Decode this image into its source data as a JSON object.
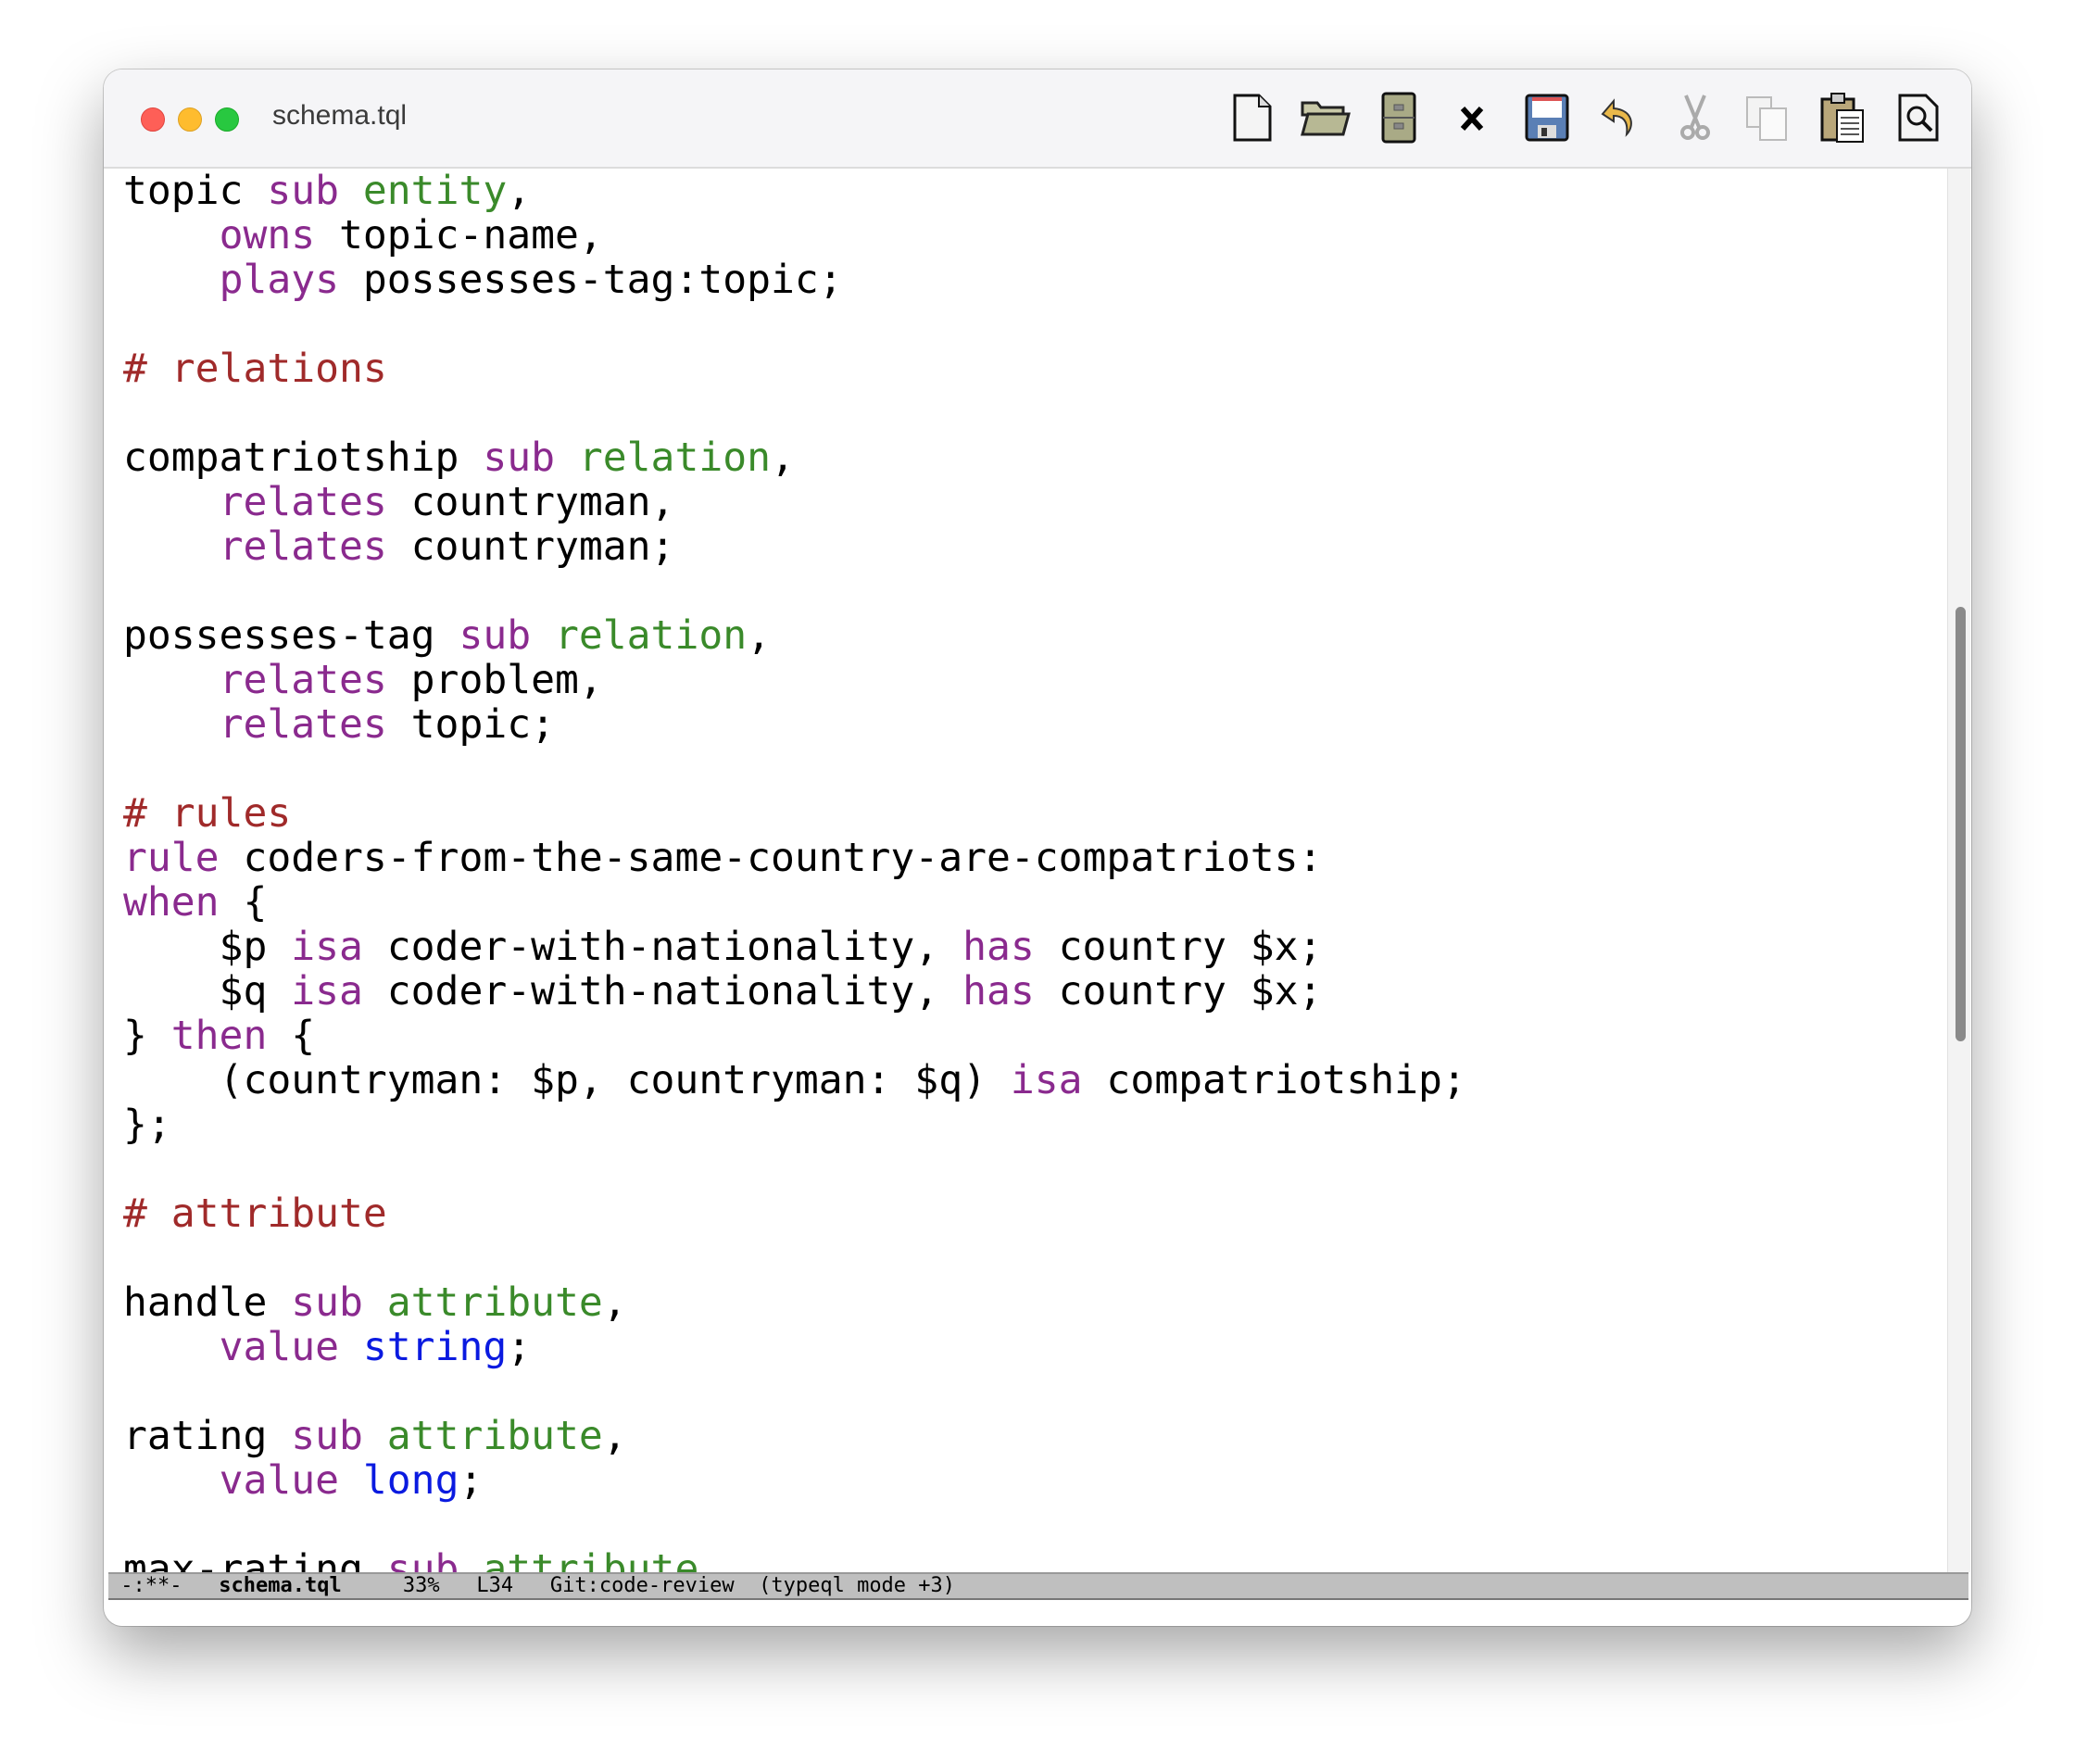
{
  "window": {
    "title": "schema.tql"
  },
  "toolbar": [
    {
      "icon": "new-file-icon"
    },
    {
      "icon": "open-folder-icon"
    },
    {
      "icon": "file-cabinet-icon"
    },
    {
      "icon": "close-icon"
    },
    {
      "icon": "save-icon"
    },
    {
      "icon": "undo-icon"
    },
    {
      "icon": "cut-icon",
      "disabled": true
    },
    {
      "icon": "copy-icon",
      "disabled": true
    },
    {
      "icon": "paste-icon"
    },
    {
      "icon": "search-icon"
    }
  ],
  "colors": {
    "keyword": "#8a2a8e",
    "type": "#3a8a2a",
    "comment": "#a02a2a",
    "builtin": "#0a1ae0"
  },
  "code_lines": [
    [
      [
        "",
        "topic "
      ],
      [
        "kw",
        "sub"
      ],
      [
        "",
        " "
      ],
      [
        "ty",
        "entity"
      ],
      [
        "",
        ","
      ]
    ],
    [
      [
        "",
        "    "
      ],
      [
        "kw",
        "owns"
      ],
      [
        "",
        " topic-name,"
      ]
    ],
    [
      [
        "",
        "    "
      ],
      [
        "kw",
        "plays"
      ],
      [
        "",
        " possesses-tag:topic;"
      ]
    ],
    [],
    [
      [
        "cm",
        "# relations"
      ]
    ],
    [],
    [
      [
        "",
        "compatriotship "
      ],
      [
        "kw",
        "sub"
      ],
      [
        "",
        " "
      ],
      [
        "ty",
        "relation"
      ],
      [
        "",
        ","
      ]
    ],
    [
      [
        "",
        "    "
      ],
      [
        "kw",
        "relates"
      ],
      [
        "",
        " countryman,"
      ]
    ],
    [
      [
        "",
        "    "
      ],
      [
        "kw",
        "relates"
      ],
      [
        "",
        " countryman;"
      ]
    ],
    [],
    [
      [
        "",
        "possesses-tag "
      ],
      [
        "kw",
        "sub"
      ],
      [
        "",
        " "
      ],
      [
        "ty",
        "relation"
      ],
      [
        "",
        ","
      ]
    ],
    [
      [
        "",
        "    "
      ],
      [
        "kw",
        "relates"
      ],
      [
        "",
        " problem,"
      ]
    ],
    [
      [
        "",
        "    "
      ],
      [
        "kw",
        "relates"
      ],
      [
        "",
        " topic;"
      ]
    ],
    [],
    [
      [
        "cm",
        "# rules"
      ]
    ],
    [
      [
        "kw",
        "rule"
      ],
      [
        "",
        " coders-from-the-same-country-are-compatriots:"
      ]
    ],
    [
      [
        "kw",
        "when"
      ],
      [
        "",
        " {"
      ]
    ],
    [
      [
        "",
        "    $p "
      ],
      [
        "kw",
        "isa"
      ],
      [
        "",
        " coder-with-nationality, "
      ],
      [
        "kw",
        "has"
      ],
      [
        "",
        " country $x;"
      ]
    ],
    [
      [
        "",
        "    $q "
      ],
      [
        "kw",
        "isa"
      ],
      [
        "",
        " coder-with-nationality, "
      ],
      [
        "kw",
        "has"
      ],
      [
        "",
        " country $x;"
      ]
    ],
    [
      [
        "",
        "} "
      ],
      [
        "kw",
        "then"
      ],
      [
        "",
        " {"
      ]
    ],
    [
      [
        "",
        "    (countryman: $p, countryman: $q) "
      ],
      [
        "kw",
        "isa"
      ],
      [
        "",
        " compatriotship;"
      ]
    ],
    [
      [
        "",
        "};"
      ]
    ],
    [],
    [
      [
        "cm",
        "# attribute"
      ]
    ],
    [],
    [
      [
        "",
        "handle "
      ],
      [
        "kw",
        "sub"
      ],
      [
        "",
        " "
      ],
      [
        "ty",
        "attribute"
      ],
      [
        "",
        ","
      ]
    ],
    [
      [
        "",
        "    "
      ],
      [
        "kw",
        "value"
      ],
      [
        "",
        " "
      ],
      [
        "bt",
        "string"
      ],
      [
        "",
        ";"
      ]
    ],
    [],
    [
      [
        "",
        "rating "
      ],
      [
        "kw",
        "sub"
      ],
      [
        "",
        " "
      ],
      [
        "ty",
        "attribute"
      ],
      [
        "",
        ","
      ]
    ],
    [
      [
        "",
        "    "
      ],
      [
        "kw",
        "value"
      ],
      [
        "",
        " "
      ],
      [
        "bt",
        "long"
      ],
      [
        "",
        ";"
      ]
    ],
    [],
    [
      [
        "",
        "max-rating "
      ],
      [
        "kw",
        "sub"
      ],
      [
        "",
        " "
      ],
      [
        "ty",
        "attribute"
      ],
      [
        "",
        ","
      ]
    ]
  ],
  "scrollbar": {
    "position_percent": 33,
    "visible_fraction": 0.31
  },
  "status_bar": {
    "state": "-:**-",
    "buffer": "schema.tql",
    "percent": "33%",
    "line": "L34",
    "vc": "Git:code-review",
    "mode": "(typeql mode +3)"
  }
}
